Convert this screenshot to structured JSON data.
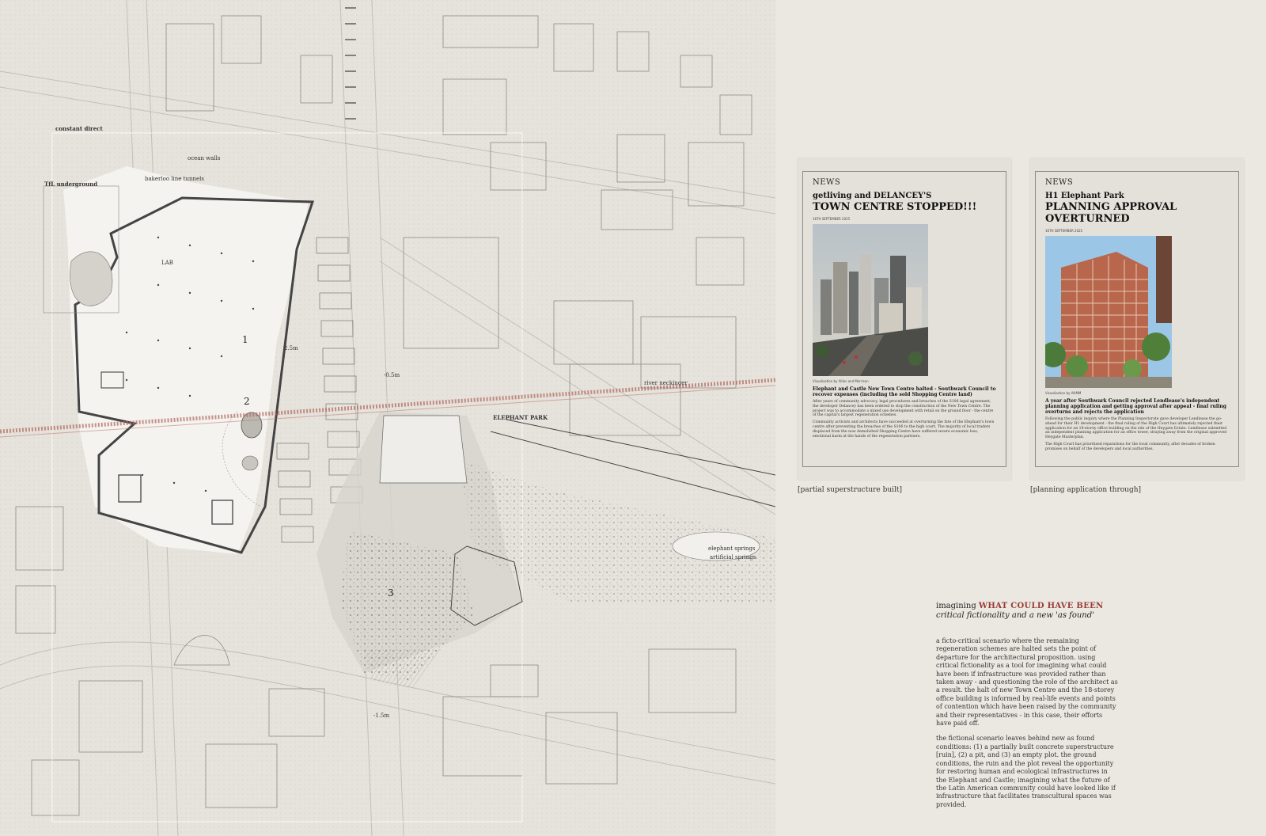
{
  "map": {
    "labels": {
      "constant_direct": "constant direct",
      "tfl_underground": "TfL underground",
      "bakerloo": "bakerloo line tunnels",
      "ocean_walls": "ocean walls",
      "river": "river neckinger",
      "elephant_park": "ELEPHANT PARK",
      "springs_1": "elephant springs",
      "springs_2": "artificial springs",
      "level_a": "2.5m",
      "level_b": "-0.5m",
      "level_c": "-1.5m",
      "lab": "LAB"
    },
    "zones": [
      "1",
      "2",
      "3"
    ],
    "colors": {
      "background": "#e6e3dc",
      "river": "#b46e64",
      "lines": "#6f6d69"
    }
  },
  "cards": [
    {
      "kicker": "NEWS",
      "subhead": "getliving and DELANCEY'S",
      "headline": "TOWN CENTRE STOPPED!!!",
      "date": "16TH SEPTEMBER 2025",
      "image_credit": "Visualisation by Allies and Morrison",
      "deck": "Elephant and Castle New Town Centre halted - Southwark Council to recover expenses (including the sold Shopping Centre land)",
      "para1": "After years of community advocacy, legal procedures and breaches of the S106 legal agreement, the developer Delancey has been ordered to stop the construction of the New Town Centre. The project was to accommodate a mixed use development with retail on the ground floor - the centre of the capital's largest regeneration schemes.",
      "para2": "Community activists and architects have succeeded at overturning the fate of the Elephant's town centre after preventing the breaches of the S106 to the high court. The majority of local traders displaced from the now demolished Shopping Centre have suffered severe economic loss, emotional harm at the hands of the regeneration partners.",
      "caption": "[partial superstructure built]"
    },
    {
      "kicker": "NEWS",
      "subhead": "H1 Elephant Park",
      "headline": "PLANNING APPROVAL OVERTURNED",
      "date": "16TH SEPTEMBER 2025",
      "image_credit": "Visualisation by AHMM",
      "deck": "A year after Southwark Council rejected Lendlease's independent planning application and getting approval after appeal - final ruling overturns and rejects the application",
      "para1": "Following the public inquiry where the Planning Inspectorate gave developer Lendlease the go-ahead for their H1 development - the final ruling of the High Court has ultimately rejected their application for an 18-storey office building on the site of the Heygate Estate. Lendlease submitted an independent planning application for an office tower, straying away from the original approved Heygate Masterplan.",
      "para2": "The High Court has prioritised reparations for the local community, after decades of broken promises on behalf of the developers and local authorities.",
      "caption": "[planning application through]"
    }
  ],
  "essay": {
    "title_lead": "imagining ",
    "title_highlight": "WHAT COULD HAVE BEEN",
    "subtitle": "critical fictionality and a new 'as found'",
    "p1": "a ficto-critical scenario where the remaining regeneration schemes are halted sets the point of departure for the architectural proposition. using critical fictionality as a tool for imagining what could have been if infrastructure was provided rather than taken away - and questioning the role of the architect as a result. the halt of new Town Centre and the 18-storey office building is informed by real-life events and points of contention which have been raised by the community and their representatives - in this case, their efforts have paid off.",
    "p2": "the fictional scenario leaves behind new as found conditions: (1) a partially built concrete superstructure [ruin], (2) a pit, and (3) an empty plot. the ground conditions, the ruin and the plot reveal the opportunity for restoring human and ecological infrastructures in the Elephant and Castle; imagining what the future of the Latin American community could have looked like if infrastructure that facilitates transcultural spaces was provided.",
    "highlight_color": "#9a3b34"
  }
}
